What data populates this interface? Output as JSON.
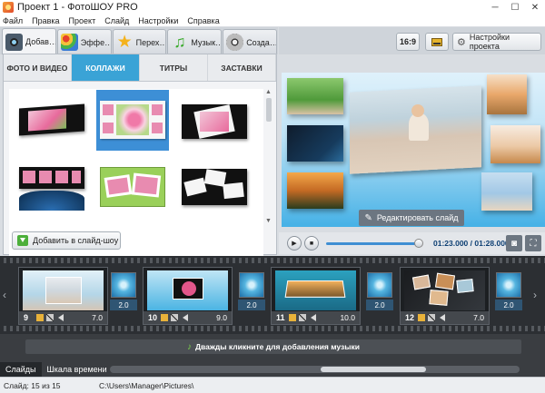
{
  "window": {
    "title": "Проект 1 - ФотоШОУ PRO"
  },
  "menu": [
    "Файл",
    "Правка",
    "Проект",
    "Слайд",
    "Настройки",
    "Справка"
  ],
  "main_tabs": [
    {
      "label": "Добав…",
      "icon": "camera-icon"
    },
    {
      "label": "Эффе…",
      "icon": "palette-icon"
    },
    {
      "label": "Перех…",
      "icon": "star-icon"
    },
    {
      "label": "Музык…",
      "icon": "music-note-icon"
    },
    {
      "label": "Созда…",
      "icon": "film-reel-icon"
    }
  ],
  "sub_tabs": [
    "ФОТО И ВИДЕО",
    "КОЛЛАЖИ",
    "ТИТРЫ",
    "ЗАСТАВКИ"
  ],
  "add_button": "Добавить в слайд-шоу",
  "toolbar": {
    "ratio": "16:9",
    "settings": "Настройки проекта"
  },
  "preview": {
    "edit_button": "Редактировать слайд"
  },
  "player": {
    "timecode": "01:23.000 / 01:28.000",
    "progress": 0.94
  },
  "slides": [
    {
      "num": "9",
      "dur": "7.0"
    },
    {
      "num": "10",
      "dur": "9.0"
    },
    {
      "num": "11",
      "dur": "10.0"
    },
    {
      "num": "12",
      "dur": "7.0"
    }
  ],
  "transitions": [
    "2.0",
    "2.0",
    "2.0",
    "2.0"
  ],
  "music_hint": "Дважды кликните для добавления музыки",
  "bottom_tabs": [
    "Слайды",
    "Шкала времени"
  ],
  "status": {
    "slide": "Слайд: 15 из 15",
    "path": "C:\\Users\\Manager\\Pictures\\"
  }
}
